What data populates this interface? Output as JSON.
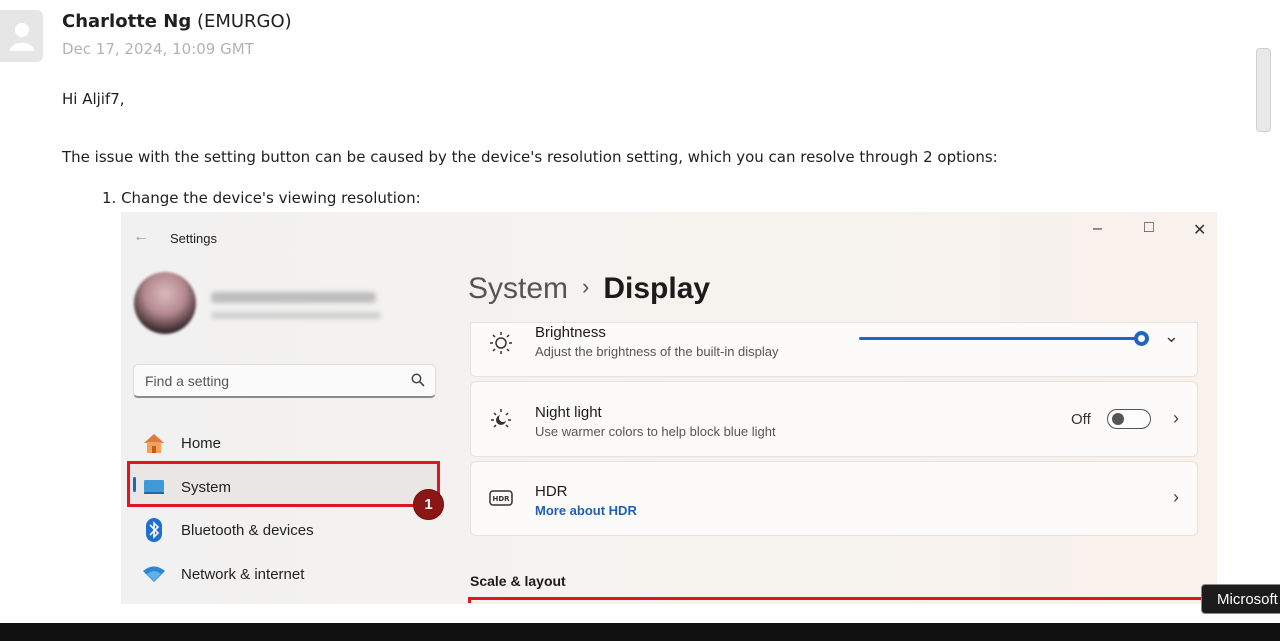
{
  "post": {
    "author_name": "Charlotte Ng",
    "author_org": "(EMURGO)",
    "date": "Dec 17, 2024, 10:09 GMT",
    "greeting": "Hi Aljif7,",
    "paragraph": "The issue with the setting button can be caused by the device's resolution setting, which you can resolve through 2 options:",
    "step_1": "1. Change the device's viewing resolution:"
  },
  "settings_window": {
    "app_title": "Settings",
    "search_placeholder": "Find a setting",
    "nav": [
      {
        "label": "Home",
        "icon": "home-icon"
      },
      {
        "label": "System",
        "icon": "monitor-icon"
      },
      {
        "label": "Bluetooth & devices",
        "icon": "bluetooth-icon"
      },
      {
        "label": "Network & internet",
        "icon": "wifi-icon"
      }
    ],
    "annotation_badge": "1",
    "breadcrumb": {
      "parent": "System",
      "current": "Display"
    },
    "cards": [
      {
        "title": "Brightness",
        "subtitle": "Adjust the brightness of the built-in display",
        "icon": "brightness-icon",
        "slider_value": 1.0
      },
      {
        "title": "Night light",
        "subtitle": "Use warmer colors to help block blue light",
        "icon": "night-light-icon",
        "toggle_label": "Off",
        "toggle_on": false
      },
      {
        "title": "HDR",
        "link": "More about HDR",
        "icon": "hdr-icon"
      }
    ],
    "section_label": "Scale & layout"
  },
  "tooltip": "Microsoft",
  "colors": {
    "accent": "#1f66c4",
    "highlight_red": "#e0151f",
    "badge": "#8c1515"
  }
}
